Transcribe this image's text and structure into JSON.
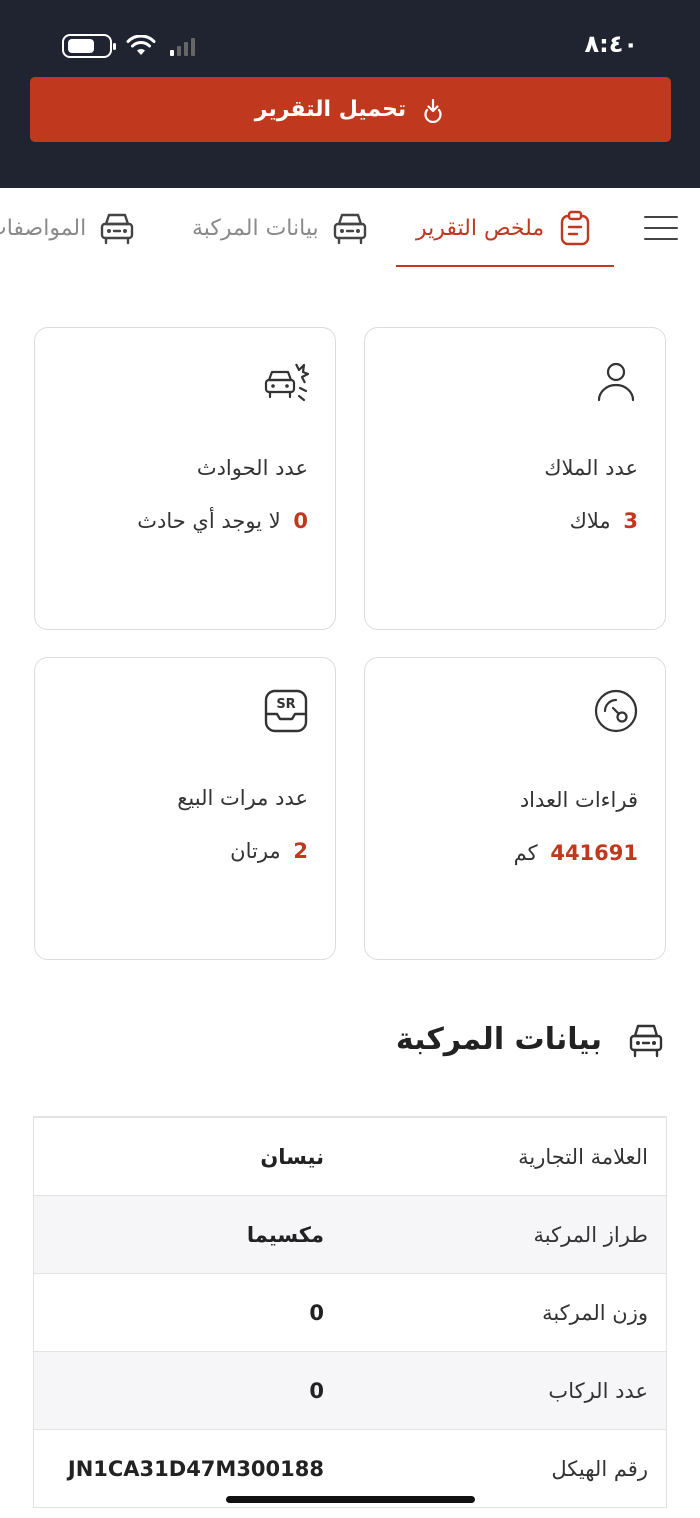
{
  "status_bar": {
    "time": "٨:٤٠"
  },
  "header": {
    "download_label": "تحميل التقرير"
  },
  "tabs": [
    {
      "label": "ملخص التقرير",
      "active": true,
      "icon": "clipboard-icon"
    },
    {
      "label": "بيانات المركبة",
      "active": false,
      "icon": "car-icon"
    },
    {
      "label": "المواصفات",
      "active": false,
      "icon": "car-icon"
    }
  ],
  "summary": {
    "owners": {
      "label": "عدد الملاك",
      "count": "3",
      "unit": "ملاك",
      "icon": "user-icon"
    },
    "accidents": {
      "label": "عدد الحوادث",
      "count": "0",
      "unit": "لا يوجد أي حادث",
      "icon": "car-crash-icon"
    },
    "odometer": {
      "label": "قراءات العداد",
      "count": "441691",
      "unit": "كم",
      "icon": "odometer-icon"
    },
    "sales": {
      "label": "عدد مرات البيع",
      "count": "2",
      "unit": "مرتان",
      "icon": "sr-tray-icon"
    }
  },
  "vehicle_section": {
    "title": "بيانات المركبة",
    "rows": [
      {
        "key": "العلامة التجارية",
        "value": "نيسان"
      },
      {
        "key": "طراز المركبة",
        "value": "مكسيما"
      },
      {
        "key": "وزن المركبة",
        "value": "0"
      },
      {
        "key": "عدد الركاب",
        "value": "0"
      },
      {
        "key": "رقم الهيكل",
        "value": "JN1CA31D47M300188"
      }
    ]
  },
  "colors": {
    "accent": "#c0391e",
    "header_bg": "#1f2430"
  }
}
